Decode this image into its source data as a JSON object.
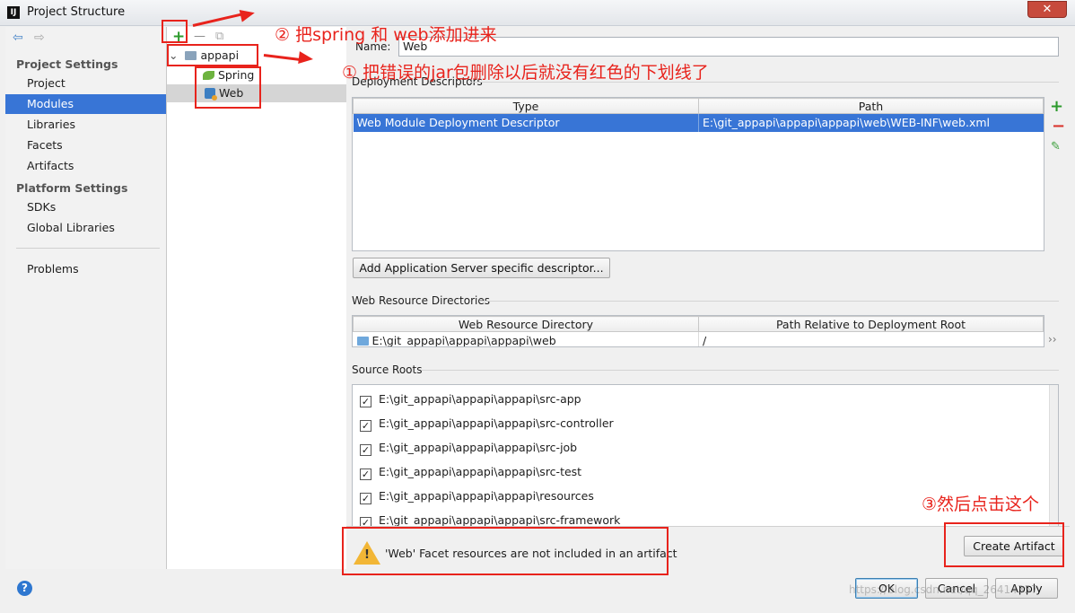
{
  "window": {
    "title": "Project Structure",
    "logo_text": "IJ",
    "close_symbol": "✕"
  },
  "sidebar": {
    "project_settings_header": "Project Settings",
    "project_items": [
      "Project",
      "Modules",
      "Libraries",
      "Facets",
      "Artifacts"
    ],
    "selected_item": "Modules",
    "platform_settings_header": "Platform Settings",
    "platform_items": [
      "SDKs",
      "Global Libraries"
    ],
    "problems_label": "Problems",
    "back_icon": "arrow-left-icon",
    "forward_icon": "arrow-right-icon"
  },
  "tree": {
    "root": "appapi",
    "children": [
      "Spring",
      "Web"
    ],
    "selected_child": "Web",
    "add_symbol": "+",
    "remove_symbol": "—",
    "copy_icon": "copy-icon"
  },
  "main": {
    "name_label": "Name:",
    "name_value": "Web",
    "deployment_descriptors_title": "Deployment Descriptors",
    "dd_columns": [
      "Type",
      "Path"
    ],
    "dd_rows": [
      [
        "Web Module Deployment Descriptor",
        "E:\\git_appapi\\appapi\\appapi\\web\\WEB-INF\\web.xml"
      ]
    ],
    "add_server_descriptor_button": "Add Application Server specific descriptor...",
    "web_resource_title": "Web Resource Directories",
    "wr_columns": [
      "Web Resource Directory",
      "Path Relative to Deployment Root"
    ],
    "wr_rows": [
      [
        "E:\\git_appapi\\appapi\\appapi\\web",
        "/"
      ]
    ],
    "wr_more": "››",
    "source_roots_title": "Source Roots",
    "source_roots": [
      "E:\\git_appapi\\appapi\\appapi\\src-app",
      "E:\\git_appapi\\appapi\\appapi\\src-controller",
      "E:\\git_appapi\\appapi\\appapi\\src-job",
      "E:\\git_appapi\\appapi\\appapi\\src-test",
      "E:\\git_appapi\\appapi\\appapi\\resources",
      "E:\\git_appapi\\appapi\\appapi\\src-framework"
    ],
    "warning_text": "'Web' Facet resources are not included in an artifact",
    "create_artifact_button": "Create Artifact"
  },
  "footer": {
    "help_symbol": "?",
    "ok_button": "OK",
    "cancel_button": "Cancel",
    "apply_button": "Apply"
  },
  "annotations": {
    "note_1": "① 把错误的jar包删除以后就没有红色的下划线了",
    "note_2": "② 把spring 和 web添加进来",
    "note_3": "③然后点击这个",
    "color": "#e8231c"
  },
  "watermark": "https://blog.csdn.net/qq_26414357",
  "colors": {
    "selection": "#3875d6",
    "accent_green": "#2c9a2c",
    "accent_red": "#d9352d",
    "warning_yellow": "#f2b636"
  }
}
